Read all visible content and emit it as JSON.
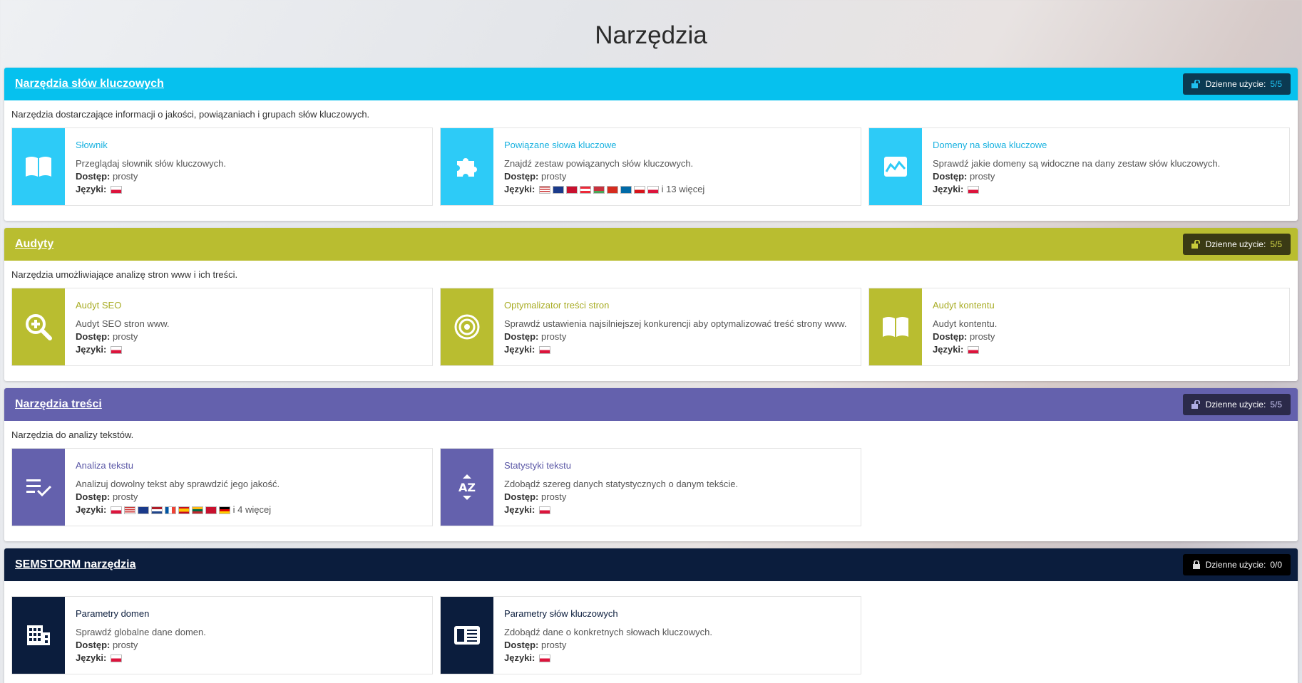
{
  "page_title": "Narzędzia",
  "sections": [
    {
      "title": "Narzędzia słów kluczowych",
      "usage_label": "Dzienne użycie:",
      "usage_value": "5/5",
      "description": "Narzędzia dostarczające informacji o jakości, powiązaniach i grupach słów kluczowych.",
      "color": "#06c1ee",
      "cards": [
        {
          "title": "Słownik",
          "desc": "Przeglądaj słownik słów kluczowych.",
          "access_label": "Dostęp:",
          "access": "prosty",
          "lang_label": "Języki:",
          "more": "",
          "icon": "book-icon"
        },
        {
          "title": "Powiązane słowa kluczowe",
          "desc": "Znajdź zestaw powiązanych słów kluczowych.",
          "access_label": "Dostęp:",
          "access": "prosty",
          "lang_label": "Języki:",
          "more": "i 13 więcej",
          "icon": "puzzle-icon"
        },
        {
          "title": "Domeny na słowa kluczowe",
          "desc": "Sprawdź jakie domeny są widoczne na dany zestaw słów kluczowych.",
          "access_label": "Dostęp:",
          "access": "prosty",
          "lang_label": "Języki:",
          "more": "",
          "icon": "chart-icon"
        }
      ]
    },
    {
      "title": "Audyty",
      "usage_label": "Dzienne użycie:",
      "usage_value": "5/5",
      "description": "Narzędzia umożliwiające analizę stron www i ich treści.",
      "color": "#b9bd30",
      "cards": [
        {
          "title": "Audyt SEO",
          "desc": "Audyt SEO stron www.",
          "access_label": "Dostęp:",
          "access": "prosty",
          "lang_label": "Języki:",
          "more": "",
          "icon": "search-plus-icon"
        },
        {
          "title": "Optymalizator treści stron",
          "desc": "Sprawdź ustawienia najsilniejszej konkurencji aby optymalizować treść strony www.",
          "access_label": "Dostęp:",
          "access": "prosty",
          "lang_label": "Języki:",
          "more": "",
          "icon": "target-icon"
        },
        {
          "title": "Audyt kontentu",
          "desc": "Audyt kontentu.",
          "access_label": "Dostęp:",
          "access": "prosty",
          "lang_label": "Języki:",
          "more": "",
          "icon": "book-icon"
        }
      ]
    },
    {
      "title": "Narzędzia treści",
      "usage_label": "Dzienne użycie:",
      "usage_value": "5/5",
      "description": "Narzędzia do analizy tekstów.",
      "color": "#6461ad",
      "cards": [
        {
          "title": "Analiza tekstu",
          "desc": "Analizuj dowolny tekst aby sprawdzić jego jakość.",
          "access_label": "Dostęp:",
          "access": "prosty",
          "lang_label": "Języki:",
          "more": "i 4 więcej",
          "icon": "list-check-icon"
        },
        {
          "title": "Statystyki tekstu",
          "desc": "Zdobądź szereg danych statystycznych o danym tekście.",
          "access_label": "Dostęp:",
          "access": "prosty",
          "lang_label": "Języki:",
          "more": "",
          "icon": "sort-az-icon"
        }
      ]
    },
    {
      "title": "SEMSTORM narzędzia",
      "usage_label": "Dzienne użycie:",
      "usage_value": "0/0",
      "description": "",
      "color": "#0b1d3d",
      "cards": [
        {
          "title": "Parametry domen",
          "desc": "Sprawdź globalne dane domen.",
          "access_label": "Dostęp:",
          "access": "prosty",
          "lang_label": "Języki:",
          "more": "",
          "icon": "building-icon"
        },
        {
          "title": "Parametry słów kluczowych",
          "desc": "Zdobądź dane o konkretnych słowach kluczowych.",
          "access_label": "Dostęp:",
          "access": "prosty",
          "lang_label": "Języki:",
          "more": "",
          "icon": "newspaper-icon"
        }
      ]
    }
  ]
}
